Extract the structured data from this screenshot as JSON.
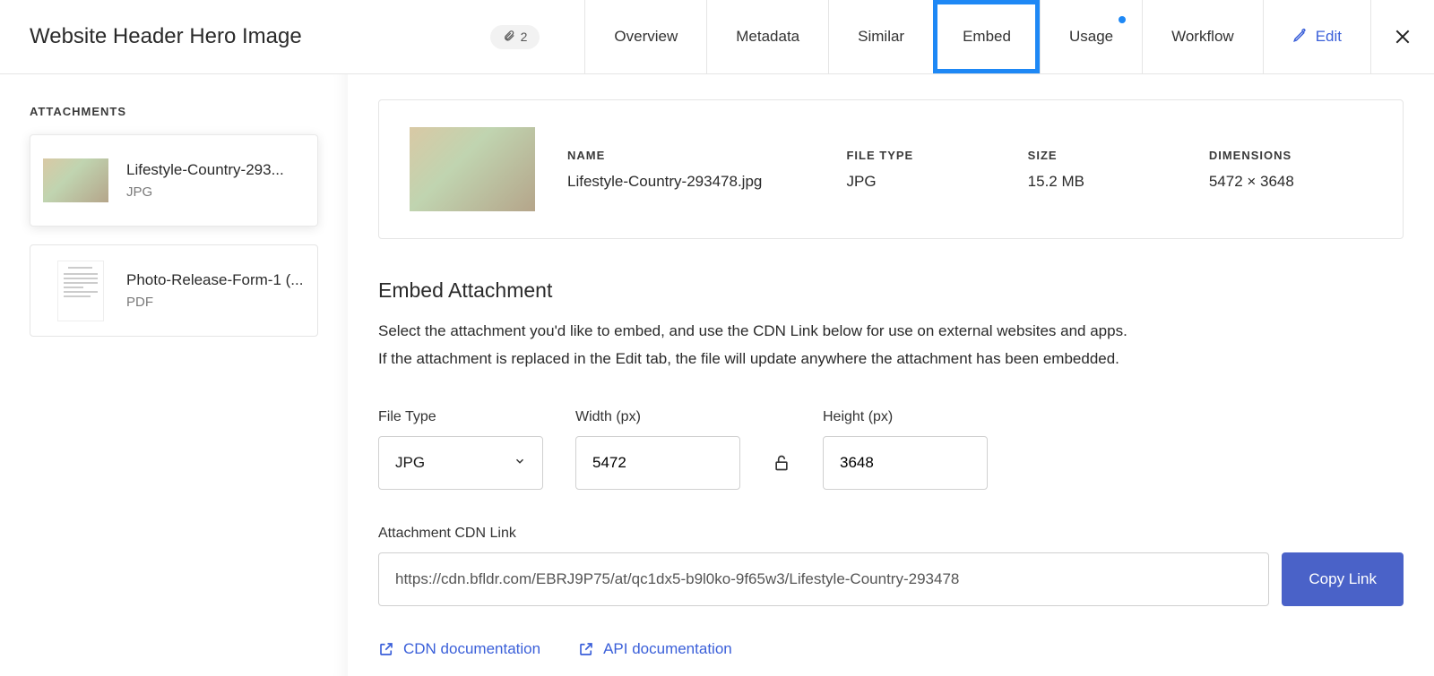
{
  "header": {
    "title": "Website Header Hero Image",
    "attachment_count": "2"
  },
  "tabs": {
    "overview": "Overview",
    "metadata": "Metadata",
    "similar": "Similar",
    "embed": "Embed",
    "usage": "Usage",
    "workflow": "Workflow",
    "edit": "Edit"
  },
  "sidebar": {
    "heading": "ATTACHMENTS",
    "items": [
      {
        "name": "Lifestyle-Country-293...",
        "type": "JPG"
      },
      {
        "name": "Photo-Release-Form-1 (...",
        "type": "PDF"
      }
    ]
  },
  "info": {
    "name_label": "NAME",
    "name_value": "Lifestyle-Country-293478.jpg",
    "type_label": "FILE TYPE",
    "type_value": "JPG",
    "size_label": "SIZE",
    "size_value": "15.2 MB",
    "dim_label": "DIMENSIONS",
    "dim_value": "5472 × 3648"
  },
  "embed": {
    "title": "Embed Attachment",
    "desc1": "Select the attachment you'd like to embed, and use the CDN Link below for use on external websites and apps.",
    "desc2": "If the attachment is replaced in the Edit tab, the file will update anywhere the attachment has been embedded.",
    "file_type_label": "File Type",
    "file_type_value": "JPG",
    "width_label": "Width (px)",
    "width_value": "5472",
    "height_label": "Height (px)",
    "height_value": "3648",
    "cdn_label": "Attachment CDN Link",
    "cdn_value": "https://cdn.bfldr.com/EBRJ9P75/at/qc1dx5-b9l0ko-9f65w3/Lifestyle-Country-293478",
    "copy_label": "Copy Link",
    "cdn_doc_link": "CDN documentation",
    "api_doc_link": "API documentation"
  }
}
